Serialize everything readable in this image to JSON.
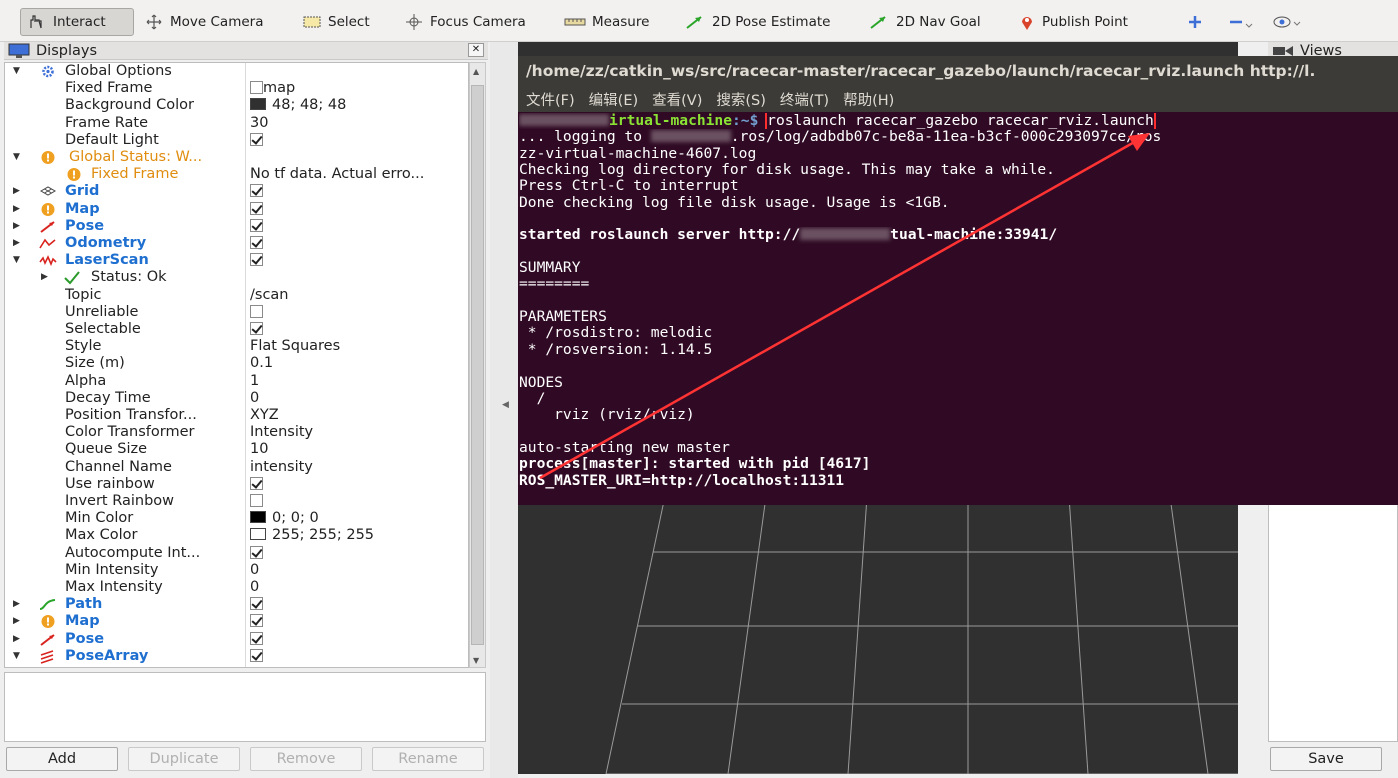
{
  "toolbar": {
    "interact": "Interact",
    "move_camera": "Move Camera",
    "select": "Select",
    "focus_camera": "Focus Camera",
    "measure": "Measure",
    "pose_estimate": "2D Pose Estimate",
    "nav_goal": "2D Nav Goal",
    "publish_point": "Publish Point"
  },
  "displays": {
    "title": "Displays",
    "close": "✕",
    "rows": [
      {
        "name": "Global Options",
        "value": ""
      },
      {
        "name": "Fixed Frame",
        "value": "map"
      },
      {
        "name": "Background Color",
        "value": "48; 48; 48",
        "swatch": "#303030"
      },
      {
        "name": "Frame Rate",
        "value": "30"
      },
      {
        "name": "Default Light",
        "value": ""
      },
      {
        "name": "Global Status: W...",
        "value": ""
      },
      {
        "name": "Fixed Frame",
        "value": "No tf data.  Actual erro..."
      },
      {
        "name": "Grid",
        "value": ""
      },
      {
        "name": "Map",
        "value": ""
      },
      {
        "name": "Pose",
        "value": ""
      },
      {
        "name": "Odometry",
        "value": ""
      },
      {
        "name": "LaserScan",
        "value": ""
      },
      {
        "name": "Status: Ok",
        "value": ""
      },
      {
        "name": "Topic",
        "value": "/scan"
      },
      {
        "name": "Unreliable",
        "value": ""
      },
      {
        "name": "Selectable",
        "value": ""
      },
      {
        "name": "Style",
        "value": "Flat Squares"
      },
      {
        "name": "Size (m)",
        "value": "0.1"
      },
      {
        "name": "Alpha",
        "value": "1"
      },
      {
        "name": "Decay Time",
        "value": "0"
      },
      {
        "name": "Position Transfor...",
        "value": "XYZ"
      },
      {
        "name": "Color Transformer",
        "value": "Intensity"
      },
      {
        "name": "Queue Size",
        "value": "10"
      },
      {
        "name": "Channel Name",
        "value": "intensity"
      },
      {
        "name": "Use rainbow",
        "value": ""
      },
      {
        "name": "Invert Rainbow",
        "value": ""
      },
      {
        "name": "Min Color",
        "value": "0; 0; 0",
        "swatch": "#000000"
      },
      {
        "name": "Max Color",
        "value": "255; 255; 255",
        "swatch": "#ffffff"
      },
      {
        "name": "Autocompute Int...",
        "value": ""
      },
      {
        "name": "Min Intensity",
        "value": "0"
      },
      {
        "name": "Max Intensity",
        "value": "0"
      },
      {
        "name": "Path",
        "value": ""
      },
      {
        "name": "Map",
        "value": ""
      },
      {
        "name": "Pose",
        "value": ""
      },
      {
        "name": "PoseArray",
        "value": ""
      }
    ]
  },
  "buttons": {
    "add": "Add",
    "duplicate": "Duplicate",
    "remove": "Remove",
    "rename": "Rename"
  },
  "views": {
    "title": "Views",
    "save": "Save"
  },
  "terminal": {
    "title": "/home/zz/catkin_ws/src/racecar-master/racecar_gazebo/launch/racecar_rviz.launch http://l.",
    "menu": [
      "文件(F)",
      "编辑(E)",
      "查看(V)",
      "搜索(S)",
      "终端(T)",
      "帮助(H)"
    ],
    "prompt_host": "irtual-machine",
    "prompt_path": ":~$ ",
    "command": "roslaunch racecar_gazebo racecar_rviz.launch",
    "line_logging_a": "... logging to ",
    "line_logging_b": ".ros/log/adbdb07c-be8a-11ea-b3cf-000c293097ce/ros",
    "line_logfile": "zz-virtual-machine-4607.log",
    "line_check": "Checking log directory for disk usage. This may take a while.",
    "line_ctrlc": "Press Ctrl-C to interrupt",
    "line_done": "Done checking log file disk usage. Usage is <1GB.",
    "line_server_a": "started roslaunch server http://",
    "line_server_b": "tual-machine:33941/",
    "summary": "SUMMARY",
    "summary_rule": "========",
    "parameters": "PARAMETERS",
    "param1": " * /rosdistro: melodic",
    "param2": " * /rosversion: 1.14.5",
    "nodes": "NODES",
    "nodes_root": "  /",
    "nodes_rviz": "    rviz (rviz/rviz)",
    "auto_master": "auto-starting new master",
    "process": "process[master]: started with pid [4617]",
    "master_uri": "ROS_MASTER_URI=http://localhost:11311"
  },
  "colors": {
    "annotation_red": "#ff3333",
    "terminal_bg": "#300a24",
    "rviz_bg": "#303030"
  }
}
